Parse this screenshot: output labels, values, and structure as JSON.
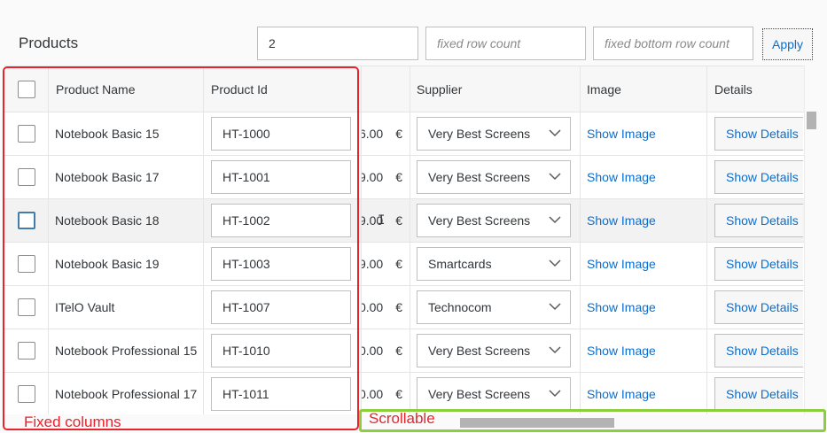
{
  "toolbar": {
    "title": "Products",
    "count_value": "2",
    "fixed_row_placeholder": "fixed row count",
    "fixed_bottom_placeholder": "fixed bottom row count",
    "apply_label": "Apply"
  },
  "table": {
    "headers": {
      "name": "Product Name",
      "pid": "Product Id",
      "price": "",
      "supplier": "Supplier",
      "image": "Image",
      "details": "Details"
    },
    "rows": [
      {
        "name": "Notebook Basic 15",
        "pid": "HT-1000",
        "price": "6.00",
        "currency": "€",
        "supplier": "Very Best Screens",
        "image": "Show Image",
        "details": "Show Details"
      },
      {
        "name": "Notebook Basic 17",
        "pid": "HT-1001",
        "price": "9.00",
        "currency": "€",
        "supplier": "Very Best Screens",
        "image": "Show Image",
        "details": "Show Details"
      },
      {
        "name": "Notebook Basic 18",
        "pid": "HT-1002",
        "price": "9.00",
        "currency": "€",
        "supplier": "Very Best Screens",
        "image": "Show Image",
        "details": "Show Details"
      },
      {
        "name": "Notebook Basic 19",
        "pid": "HT-1003",
        "price": "9.00",
        "currency": "€",
        "supplier": "Smartcards",
        "image": "Show Image",
        "details": "Show Details"
      },
      {
        "name": "ITelO Vault",
        "pid": "HT-1007",
        "price": "0.00",
        "currency": "€",
        "supplier": "Technocom",
        "image": "Show Image",
        "details": "Show Details"
      },
      {
        "name": "Notebook Professional 15",
        "pid": "HT-1010",
        "price": "0.00",
        "currency": "€",
        "supplier": "Very Best Screens",
        "image": "Show Image",
        "details": "Show Details"
      },
      {
        "name": "Notebook Professional 17",
        "pid": "HT-1011",
        "price": "0.00",
        "currency": "€",
        "supplier": "Very Best Screens",
        "image": "Show Image",
        "details": "Show Details"
      }
    ]
  },
  "annotations": {
    "fixed_label": "Fixed columns",
    "scroll_label": "Scrollable",
    "fixed_color": "#e8232d",
    "scroll_color": "#8ccf3c"
  },
  "colors": {
    "link": "#0a6ed1",
    "focus_border": "#427cac"
  }
}
